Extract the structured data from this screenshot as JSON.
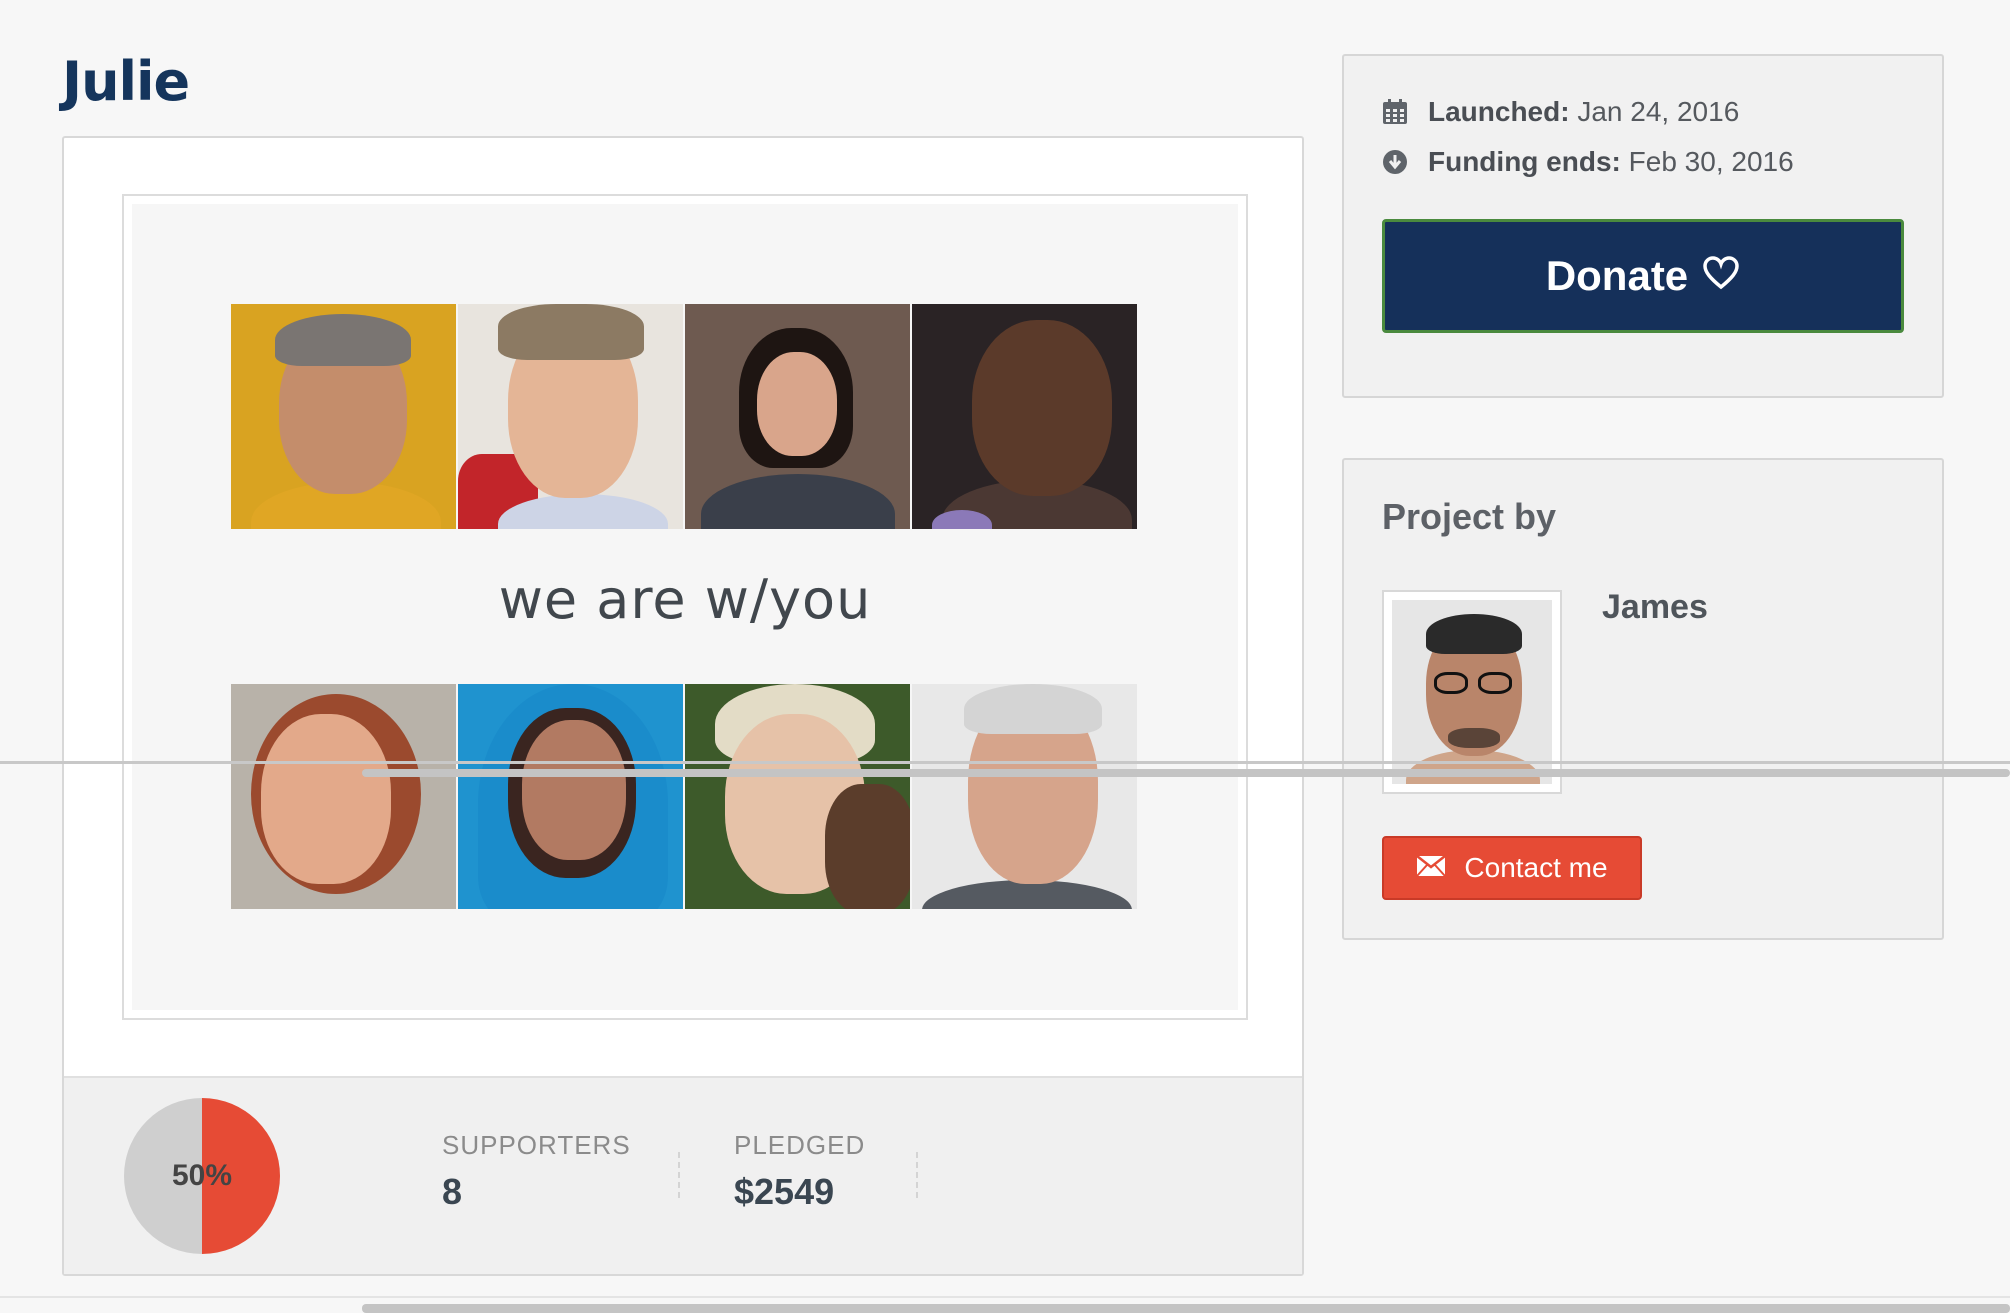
{
  "project": {
    "title": "Julie",
    "tagline": "we are w/you"
  },
  "stats": {
    "percent_funded": 0.5,
    "percent_label": "50%",
    "supporters_label": "SUPPORTERS",
    "supporters_value": "8",
    "pledged_label": "PLEDGED",
    "pledged_value": "$2549"
  },
  "dates": {
    "launched_label": "Launched:",
    "launched_value": "Jan 24, 2016",
    "ends_label": "Funding ends:",
    "ends_value": "Feb 30, 2016",
    "launched_icon": "calendar-icon",
    "ends_icon": "arrow-down-circle-icon"
  },
  "donate": {
    "label": "Donate",
    "icon": "heart-outline-icon"
  },
  "creator": {
    "heading": "Project by",
    "name": "James",
    "contact_label": "Contact me",
    "contact_icon": "envelope-icon"
  },
  "colors": {
    "title": "#15355c",
    "donate_bg": "#15305a",
    "contact_bg": "#e64b35",
    "pie_fill": "#e64b35",
    "pie_rest": "#cfcfcf"
  }
}
